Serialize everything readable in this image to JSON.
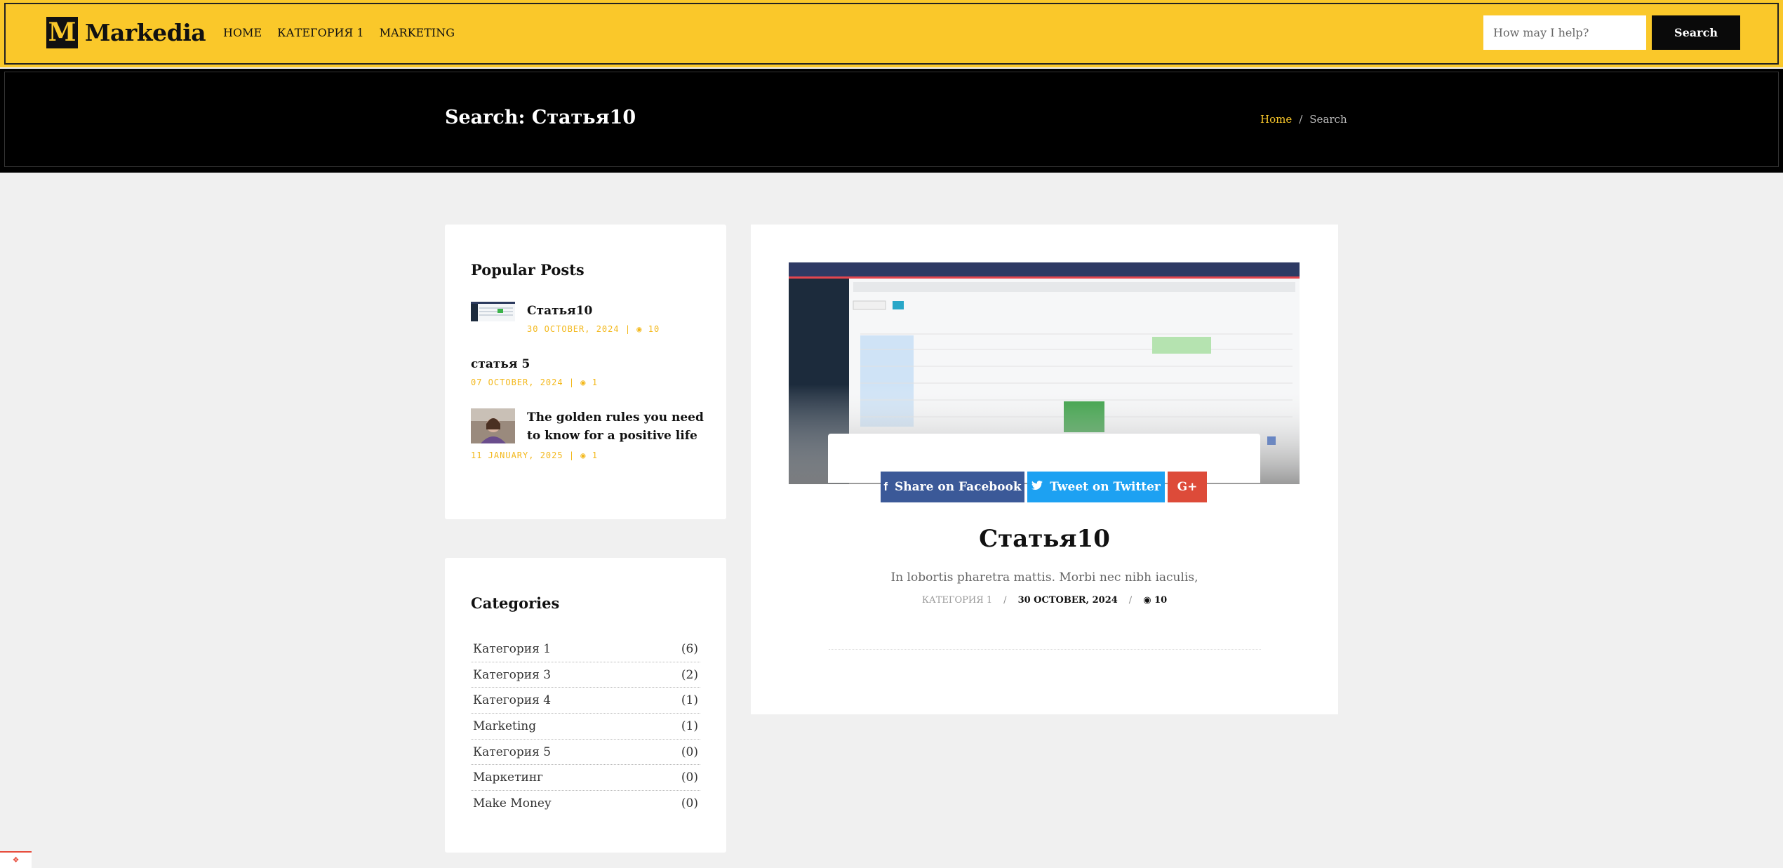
{
  "header": {
    "logo_letter": "M",
    "logo_text": "Markedia",
    "nav": [
      "HOME",
      "КАТЕГОРИЯ 1",
      "MARKETING"
    ],
    "search_placeholder": "How may I help?",
    "search_button": "Search"
  },
  "band": {
    "title": "Search: Статья10",
    "breadcrumb_home": "Home",
    "breadcrumb_sep": "/",
    "breadcrumb_current": "Search"
  },
  "popular": {
    "title": "Popular Posts",
    "posts": [
      {
        "title": "Статья10",
        "meta": "30 OCTOBER, 2024 | ◉ 10"
      },
      {
        "title": "статья 5",
        "meta": "07 OCTOBER, 2024 | ◉ 1"
      },
      {
        "title": "The golden rules you need to know for a positive life",
        "meta": "11 JANUARY, 2025 | ◉ 1"
      }
    ]
  },
  "categories": {
    "title": "Categories",
    "items": [
      {
        "name": "Категория 1",
        "count": "(6)"
      },
      {
        "name": "Категория 3",
        "count": "(2)"
      },
      {
        "name": "Категория 4",
        "count": "(1)"
      },
      {
        "name": "Marketing",
        "count": "(1)"
      },
      {
        "name": "Категория 5",
        "count": "(0)"
      },
      {
        "name": "Маркетинг",
        "count": "(0)"
      },
      {
        "name": "Make Money",
        "count": "(0)"
      }
    ]
  },
  "post": {
    "share_facebook": "Share on Facebook",
    "share_twitter": "Tweet on Twitter",
    "share_gplus": "G+",
    "title": "Статья10",
    "excerpt": "In lobortis pharetra mattis. Morbi nec nibh iaculis,",
    "category": "КАТЕГОРИЯ 1",
    "date": "30 OCTOBER, 2024",
    "views": "10",
    "sep": "/"
  },
  "colors": {
    "brand_yellow": "#fac82a",
    "facebook": "#3b5998",
    "twitter": "#1da1f2",
    "gplus": "#dd4b39"
  }
}
